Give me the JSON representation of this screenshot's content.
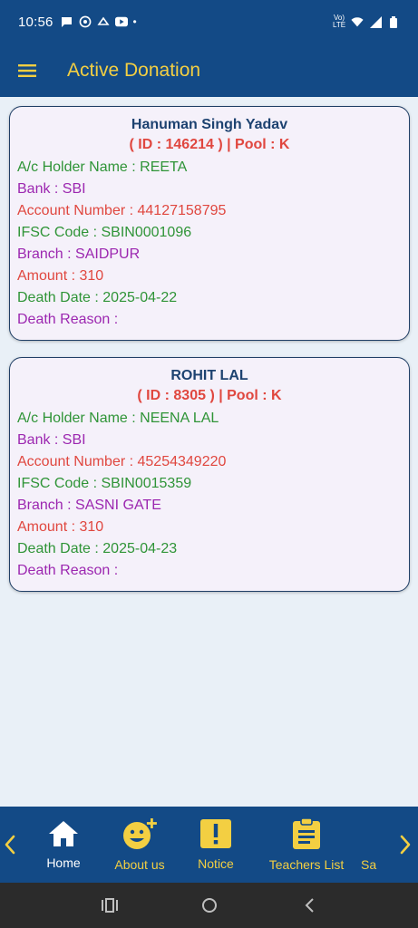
{
  "status_bar": {
    "time": "10:56",
    "network": "Vo) LTE",
    "dot": "•"
  },
  "header": {
    "title": "Active Donation"
  },
  "donations": [
    {
      "name": "Hanuman Singh Yadav",
      "id_line": "( ID : 146214 ) | Pool : K",
      "holder": "A/c Holder Name : REETA",
      "bank": "Bank : SBI",
      "account": "Account Number : 44127158795",
      "ifsc": "IFSC Code : SBIN0001096",
      "branch": "Branch : SAIDPUR",
      "amount": "Amount : 310",
      "death_date": "Death Date : 2025-04-22",
      "death_reason": "Death Reason :"
    },
    {
      "name": "ROHIT LAL",
      "id_line": "( ID : 8305 ) | Pool : K",
      "holder": "A/c Holder Name : NEENA LAL",
      "bank": "Bank : SBI",
      "account": "Account Number : 45254349220",
      "ifsc": "IFSC Code : SBIN0015359",
      "branch": "Branch : SASNI GATE",
      "amount": "Amount : 310",
      "death_date": "Death Date : 2025-04-23",
      "death_reason": "Death Reason :"
    }
  ],
  "bottom_nav": {
    "items": [
      {
        "label": "Home",
        "icon": "home-icon",
        "active": true
      },
      {
        "label": "About us",
        "icon": "emoji-add-icon",
        "active": false
      },
      {
        "label": "Notice",
        "icon": "alert-box-icon",
        "active": false
      },
      {
        "label": "Teachers List",
        "icon": "clipboard-icon",
        "active": false
      },
      {
        "label": "Sa",
        "icon": "",
        "active": false
      }
    ]
  },
  "colors": {
    "primary": "#134a86",
    "accent": "#f3cf42",
    "green": "#2f9437",
    "purple": "#9c27b0",
    "red": "#e0473f",
    "background": "#e9f0f7",
    "card": "#f5f1fa"
  }
}
